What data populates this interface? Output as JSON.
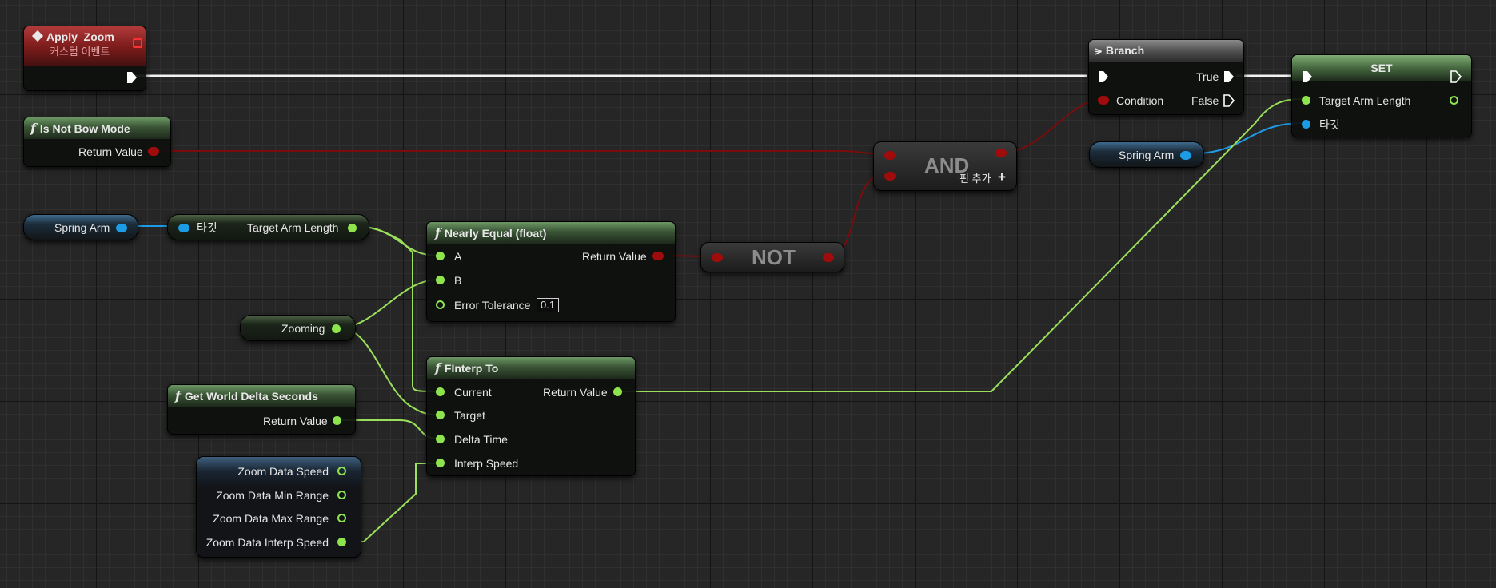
{
  "nodes": {
    "apply_zoom": {
      "title": "Apply_Zoom",
      "subtitle": "커스텀 이벤트"
    },
    "is_not_bow_mode": {
      "title": "Is Not Bow Mode",
      "return_value": "Return Value"
    },
    "branch": {
      "title": "Branch",
      "condition": "Condition",
      "true_label": "True",
      "false_label": "False"
    },
    "set": {
      "title": "SET",
      "target_arm_length": "Target Arm Length",
      "target": "타깃"
    },
    "spring_arm_right": {
      "label": "Spring Arm"
    },
    "and": {
      "label": "AND",
      "add_pin": "핀 추가"
    },
    "spring_arm_left": {
      "label": "Spring Arm"
    },
    "target_arm_length_getter": {
      "target": "타깃",
      "output": "Target Arm Length"
    },
    "nearly_equal": {
      "title": "Nearly Equal (float)",
      "a": "A",
      "b": "B",
      "error_tolerance": "Error Tolerance",
      "error_tolerance_value": "0.1",
      "return_value": "Return Value"
    },
    "not": {
      "label": "NOT"
    },
    "zooming": {
      "label": "Zooming"
    },
    "finterp_to": {
      "title": "FInterp To",
      "current": "Current",
      "target": "Target",
      "delta_time": "Delta Time",
      "interp_speed": "Interp Speed",
      "return_value": "Return Value"
    },
    "get_world_delta_seconds": {
      "title": "Get World Delta Seconds",
      "return_value": "Return Value"
    },
    "zoom_data": {
      "fields": [
        "Zoom Data Speed",
        "Zoom Data Min Range",
        "Zoom Data Max Range",
        "Zoom Data Interp Speed"
      ]
    }
  },
  "colors": {
    "exec_wire": "#ffffff",
    "bool_wire": "#8b0d0d",
    "float_wire": "#9be05a",
    "object_wire": "#1d9ce6",
    "event_header": "#8e2424",
    "function_header": "#3f5c3a"
  },
  "icons": {
    "event": "event-diamond-icon",
    "function": "function-f-icon",
    "branch": "branch-icon",
    "add_pin": "plus-icon"
  }
}
